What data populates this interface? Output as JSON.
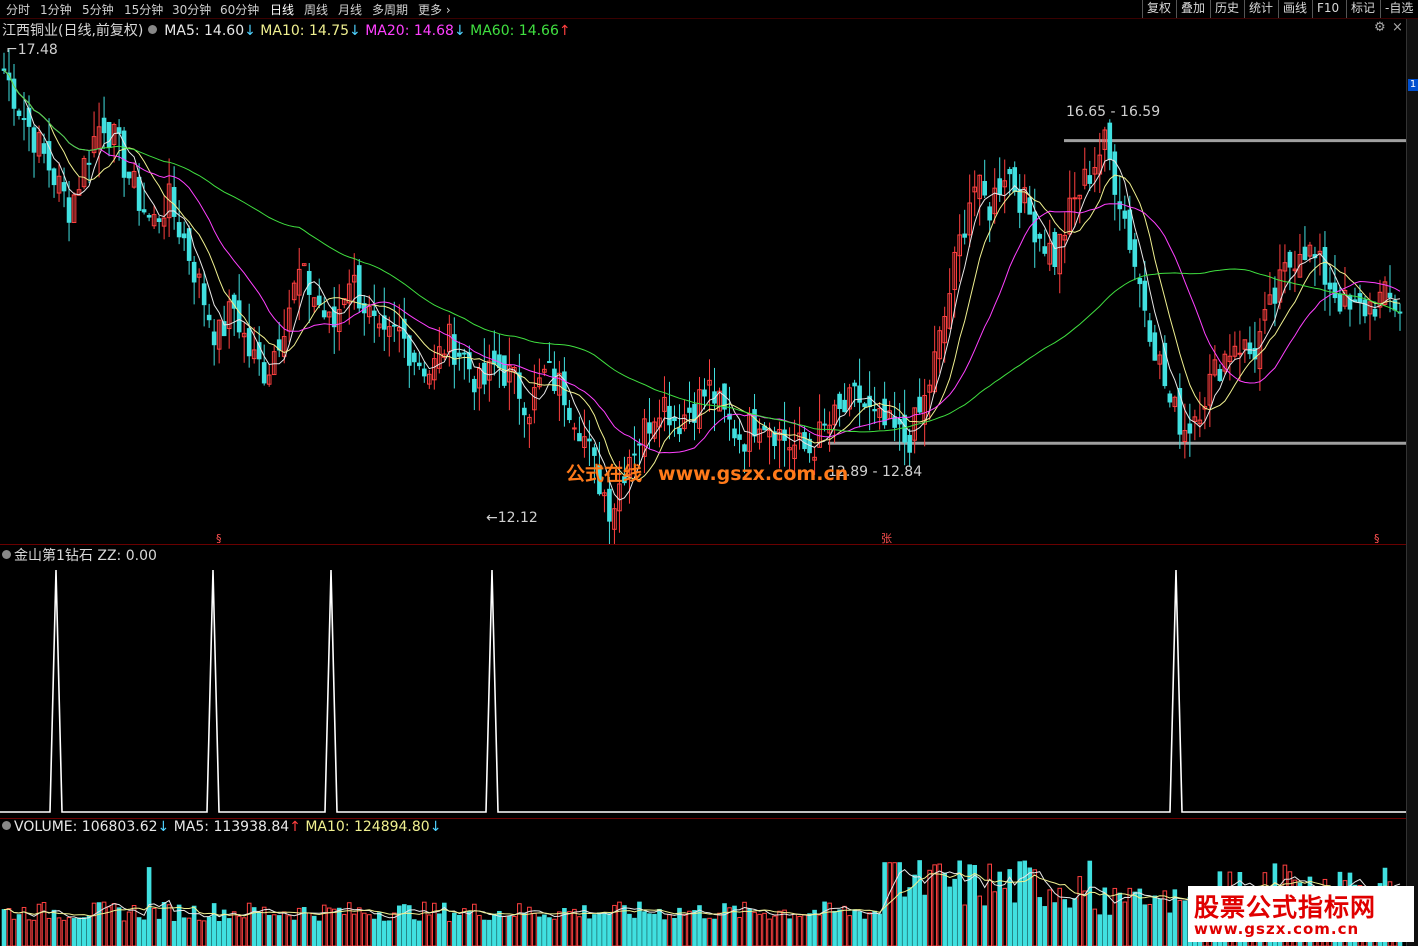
{
  "toolbar": {
    "periods": [
      "分时",
      "1分钟",
      "5分钟",
      "15分钟",
      "30分钟",
      "60分钟",
      "日线",
      "周线",
      "月线",
      "多周期",
      "更多"
    ],
    "active_period": "日线",
    "tools": [
      "复权",
      "叠加",
      "历史",
      "统计",
      "画线",
      "F10",
      "标记",
      "自选"
    ]
  },
  "main_panel": {
    "title": "江西铜业(日线,前复权)",
    "indicators": [
      {
        "label": "MA5:",
        "value": "14.60",
        "dir": "down",
        "color": "#e8e8e8"
      },
      {
        "label": "MA10:",
        "value": "14.75",
        "dir": "down",
        "color": "#f0f090"
      },
      {
        "label": "MA20:",
        "value": "14.68",
        "dir": "down",
        "color": "#ff40ff"
      },
      {
        "label": "MA60:",
        "value": "14.66",
        "dir": "up",
        "color": "#40e040"
      }
    ],
    "high_label": "17.48",
    "low_label": "12.12",
    "range_upper": "16.65 - 16.59",
    "range_lower": "12.89 - 12.84",
    "side_tag": "1"
  },
  "signal_panel": {
    "title": "金山第1钻石",
    "zz_label": "ZZ:",
    "zz_value": "0.00"
  },
  "volume_panel": {
    "indicators": [
      {
        "label": "VOLUME:",
        "value": "106803.62",
        "dir": "down",
        "color": "#e8e8e8"
      },
      {
        "label": "MA5:",
        "value": "113938.84",
        "dir": "up",
        "color": "#e8e8e8"
      },
      {
        "label": "MA10:",
        "value": "124894.80",
        "dir": "down",
        "color": "#f0f090"
      }
    ]
  },
  "watermark": {
    "text": "公式在线",
    "url": "www.gszx.com.cn"
  },
  "logo": {
    "line1": "股票公式指标网",
    "line2": "www.gszx.com.cn"
  },
  "colors": {
    "up": "#ff4040",
    "down": "#40e0e0",
    "ma5": "#e8e8e8",
    "ma10": "#f0f090",
    "ma20": "#ff40ff",
    "ma60": "#40e040"
  },
  "chart_data": {
    "type": "candlestick",
    "series_close_approx": [
      17.48,
      17.0,
      16.6,
      16.2,
      15.8,
      16.4,
      16.9,
      16.5,
      16.0,
      15.6,
      15.9,
      15.4,
      14.8,
      14.2,
      14.6,
      14.0,
      13.8,
      14.4,
      15.0,
      14.7,
      14.3,
      15.0,
      14.6,
      14.1,
      14.3,
      14.0,
      13.8,
      14.2,
      14.0,
      13.6,
      13.9,
      13.7,
      13.4,
      13.8,
      13.6,
      13.2,
      12.6,
      12.12,
      12.8,
      13.1,
      13.5,
      13.2,
      13.4,
      13.6,
      13.2,
      13.0,
      13.3,
      13.1,
      12.9,
      12.84,
      13.1,
      13.3,
      13.5,
      13.2,
      13.1,
      12.95,
      13.4,
      14.2,
      15.2,
      16.1,
      15.8,
      16.3,
      15.9,
      15.5,
      15.2,
      15.8,
      16.2,
      16.59,
      15.9,
      15.0,
      14.2,
      13.4,
      13.1,
      13.5,
      13.9,
      14.2,
      14.0,
      14.5,
      15.0,
      15.4,
      15.1,
      14.8,
      14.5,
      14.6,
      14.7,
      14.6
    ],
    "price_labels": {
      "high": 17.48,
      "low": 12.12,
      "range_upper": [
        16.65,
        16.59
      ],
      "range_lower": [
        12.89,
        12.84
      ]
    },
    "signal_spikes": [
      {
        "label": "金山第1钻石",
        "value": 1
      },
      {
        "label": "金山第1钻石",
        "value": 1
      },
      {
        "label": "金山第1钻石",
        "value": 1
      },
      {
        "label": "金山第1钻石",
        "value": 1
      },
      {
        "label": "金山第1钻石",
        "value": 1
      }
    ],
    "volume_last": 106803.62,
    "volume_ma5": 113938.84,
    "volume_ma10": 124894.8
  }
}
